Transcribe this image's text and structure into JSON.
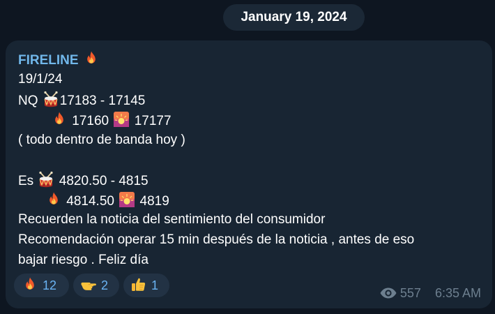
{
  "date_header": "January 19, 2024",
  "message": {
    "author": "FIRELINE",
    "lines": {
      "date": "19/1/24",
      "nq_label": "NQ",
      "nq_range": "17183 - 17145",
      "nq_fire": "17160",
      "nq_sunrise": "17177",
      "note": "( todo dentro de banda hoy )",
      "es_label": "Es",
      "es_range": "4820.50 - 4815",
      "es_fire": "4814.50",
      "es_sunrise": "4819",
      "line_a": "Recuerden la noticia del sentimiento del consumidor",
      "line_b": "Recomendación operar 15 min después de la noticia , antes de eso",
      "line_c": "bajar riesgo . Feliz día"
    },
    "reactions": [
      {
        "icon": "fire-icon",
        "count": "12"
      },
      {
        "icon": "pointing-hand-icon",
        "count": "2"
      },
      {
        "icon": "thumbs-up-icon",
        "count": "1"
      }
    ],
    "views": "557",
    "time": "6:35 AM"
  },
  "colors": {
    "background": "#0e1621",
    "bubble": "#182533",
    "author": "#71b7ea",
    "reaction_bg": "#223244",
    "reaction_text": "#6ab3f3",
    "meta": "#6d7f8f"
  }
}
